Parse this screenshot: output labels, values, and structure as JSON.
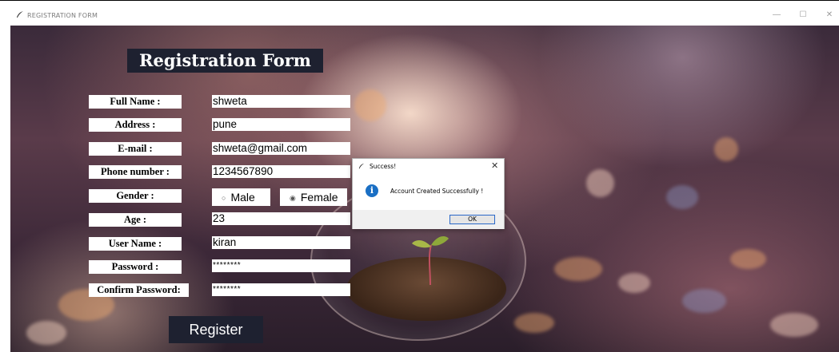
{
  "window": {
    "title": "REGISTRATION FORM",
    "icon": "feather-icon",
    "controls": {
      "minimize": "—",
      "maximize": "☐",
      "close": "✕"
    }
  },
  "form": {
    "heading": "Registration Form",
    "fields": [
      {
        "label": "Full Name :",
        "value": "shweta"
      },
      {
        "label": "Address :",
        "value": "pune"
      },
      {
        "label": "E-mail :",
        "value": "shweta@gmail.com"
      },
      {
        "label": "Phone number :",
        "value": "1234567890"
      },
      {
        "label": "Age :",
        "value": "23"
      },
      {
        "label": "User Name :",
        "value": "kiran"
      },
      {
        "label": "Password :",
        "value": "********"
      },
      {
        "label": "Confirm Password:",
        "value": "********"
      }
    ],
    "gender": {
      "label": "Gender :",
      "options": [
        "Male",
        "Female"
      ],
      "selected": "Female"
    },
    "register_label": "Register"
  },
  "dialog": {
    "title": "Success!",
    "message": "Account Created Successfully !",
    "ok_label": "OK",
    "close_glyph": "✕",
    "info_glyph": "i"
  }
}
